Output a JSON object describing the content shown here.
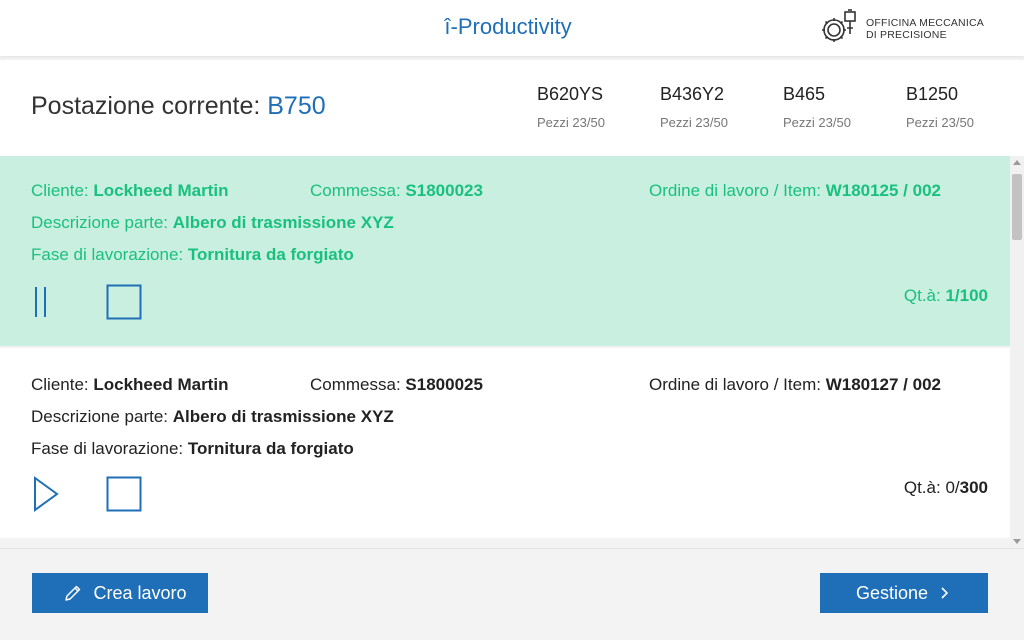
{
  "header": {
    "app_title": "î-Productivity",
    "logo_line1": "OFFICINA MECCANICA",
    "logo_line2": "DI PRECISIONE"
  },
  "station": {
    "label": "Postazione corrente: ",
    "code": "B750",
    "others": [
      {
        "name": "B620YS",
        "pieces": "Pezzi 23/50"
      },
      {
        "name": "B436Y2",
        "pieces": "Pezzi 23/50"
      },
      {
        "name": "B465",
        "pieces": "Pezzi 23/50"
      },
      {
        "name": "B1250",
        "pieces": "Pezzi 23/50"
      }
    ]
  },
  "labels": {
    "client": "Cliente: ",
    "order": "Commessa: ",
    "work_order": "Ordine di lavoro / Item: ",
    "part_desc": "Descrizione parte: ",
    "phase": "Fase di lavorazione: ",
    "qty": "Qt.à: "
  },
  "jobs": [
    {
      "status": "running",
      "client": "Lockheed Martin",
      "order": "S1800023",
      "work_order": "W180125 / 002",
      "part_desc": "Albero di trasmissione XYZ",
      "phase": "Tornitura da forgiato",
      "qty": "1/100"
    },
    {
      "status": "idle",
      "client": "Lockheed Martin",
      "order": "S1800025",
      "work_order": "W180127 / 002",
      "part_desc": "Albero di trasmissione XYZ",
      "phase": "Tornitura da forgiato",
      "qty_done": "0/",
      "qty_total": "300"
    }
  ],
  "footer": {
    "create_label": "Crea lavoro",
    "manage_label": "Gestione"
  },
  "colors": {
    "accent": "#1f6fb8",
    "active_bg": "#c9efe0",
    "active_text": "#19c07f"
  }
}
